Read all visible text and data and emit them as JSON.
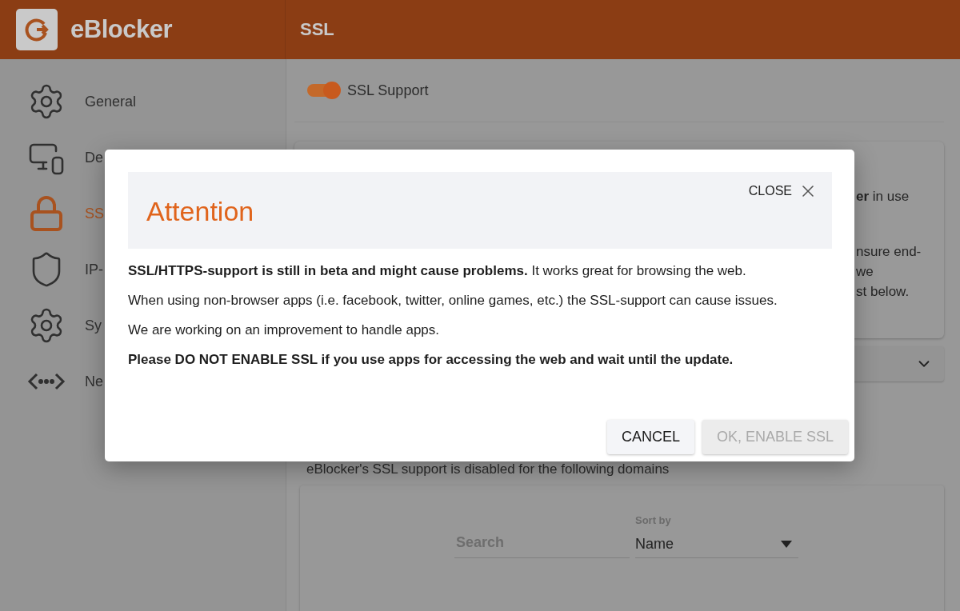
{
  "header": {
    "logo": "eBlocker",
    "page_title": "SSL"
  },
  "sidebar": {
    "items": [
      {
        "label": "General",
        "kind": "gear",
        "selected": false
      },
      {
        "label": "De",
        "kind": "devices",
        "selected": false
      },
      {
        "label": "SS",
        "kind": "lock",
        "selected": true
      },
      {
        "label": "IP-",
        "kind": "shield",
        "selected": false
      },
      {
        "label": "Sy",
        "kind": "gear",
        "selected": false
      },
      {
        "label": "Ne",
        "kind": "network",
        "selected": false
      }
    ]
  },
  "ssl_support": {
    "label": "SSL Support",
    "on": true
  },
  "info_card": {
    "lines": [
      "**er** in use",
      "nsure end-",
      "we",
      "st below."
    ]
  },
  "domains_note": "eBlocker's SSL support is disabled for the following domains",
  "domain_list": {
    "search": {
      "placeholder": "Search"
    },
    "sort": {
      "label": "Sort by",
      "value": "Name"
    }
  },
  "dialog": {
    "title": "Attention",
    "close_label": "CLOSE",
    "paragraphs": [
      {
        "text": "**SSL/HTTPS-support is still in beta and might cause problems.** It works great for browsing the web.",
        "emphasis": false
      },
      {
        "text": "When using non-browser apps (i.e. facebook, twitter, online games, etc.) the SSL-support can cause issues.",
        "emphasis": false
      },
      {
        "text": "We are working on an improvement to handle apps.",
        "emphasis": false
      },
      {
        "text": "Please DO NOT ENABLE SSL if you use apps for accessing the web and wait until the update.",
        "emphasis": true
      }
    ],
    "buttons": [
      {
        "label": "CANCEL",
        "disabled": false
      },
      {
        "label": "OK, ENABLE SSL",
        "disabled": true
      }
    ]
  }
}
